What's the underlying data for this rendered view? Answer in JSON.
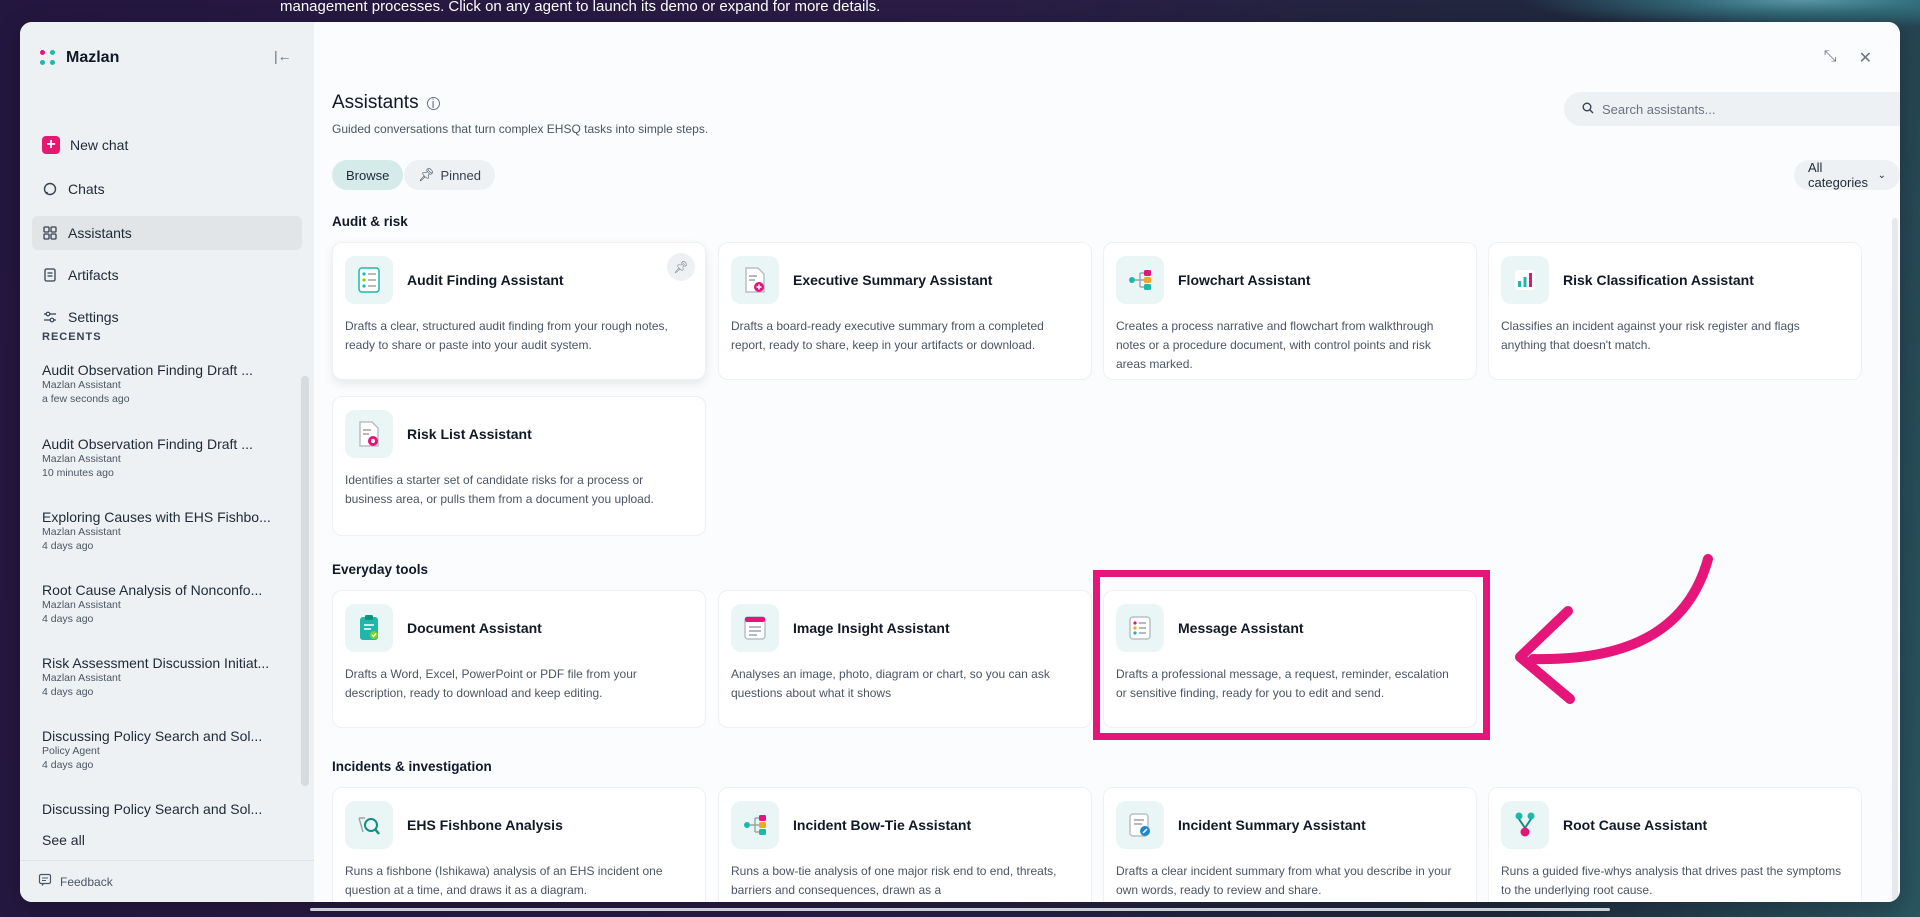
{
  "banner": {
    "text": "management processes. Click on any agent to launch its demo or expand for more details."
  },
  "sidebar": {
    "brand_name": "Mazlan",
    "nav": [
      {
        "label": "New chat",
        "icon": "plus-icon"
      },
      {
        "label": "Chats",
        "icon": "chat-bubble-icon"
      },
      {
        "label": "Assistants",
        "icon": "grid-icon"
      },
      {
        "label": "Artifacts",
        "icon": "document-icon"
      },
      {
        "label": "Settings",
        "icon": "sliders-icon"
      }
    ],
    "recents_label": "RECENTS",
    "recents": [
      {
        "title": "Audit Observation Finding Draft ...",
        "agent": "Mazlan Assistant",
        "time": "a few seconds ago"
      },
      {
        "title": "Audit Observation Finding Draft ...",
        "agent": "Mazlan Assistant",
        "time": "10 minutes ago"
      },
      {
        "title": "Exploring Causes with EHS Fishbo...",
        "agent": "Mazlan Assistant",
        "time": "4 days ago"
      },
      {
        "title": "Root Cause Analysis of Nonconfo...",
        "agent": "Mazlan Assistant",
        "time": "4 days ago"
      },
      {
        "title": "Risk Assessment Discussion Initiat...",
        "agent": "Mazlan Assistant",
        "time": "4 days ago"
      },
      {
        "title": "Discussing Policy Search and Sol...",
        "agent": "Policy Agent",
        "time": "4 days ago"
      },
      {
        "title": "Discussing Policy Search and Sol...",
        "agent": "",
        "time": ""
      }
    ],
    "see_all": "See all",
    "feedback": "Feedback"
  },
  "main": {
    "title": "Assistants",
    "subtitle": "Guided conversations that turn complex EHSQ tasks into simple steps.",
    "search_placeholder": "Search assistants...",
    "filters": {
      "browse": "Browse",
      "pinned": "Pinned"
    },
    "category_select": "All categories",
    "sections": [
      {
        "label": "Audit & risk",
        "cards": [
          {
            "title": "Audit Finding Assistant",
            "desc": "Drafts a clear, structured audit finding from your rough notes, ready to share or paste into your audit system.",
            "icon": "checklist-icon"
          },
          {
            "title": "Executive Summary Assistant",
            "desc": "Drafts a board-ready executive summary from a completed report, ready to share, keep in your artifacts or download.",
            "icon": "document-plus-icon"
          },
          {
            "title": "Flowchart Assistant",
            "desc": "Creates a process narrative and flowchart from walkthrough notes or a procedure document, with control points and risk areas marked.",
            "icon": "flowchart-icon"
          },
          {
            "title": "Risk Classification Assistant",
            "desc": "Classifies an incident against your risk register and flags anything that doesn't match.",
            "icon": "bar-chart-icon"
          },
          {
            "title": "Risk List Assistant",
            "desc": "Identifies a starter set of candidate risks for a process or business area, or pulls them from a document you upload.",
            "icon": "document-badge-icon"
          }
        ]
      },
      {
        "label": "Everyday tools",
        "cards": [
          {
            "title": "Document Assistant",
            "desc": "Drafts a Word, Excel, PowerPoint or PDF file from your description, ready to download and keep editing.",
            "icon": "clipboard-check-icon"
          },
          {
            "title": "Image Insight Assistant",
            "desc": "Analyses an image, photo, diagram or chart, so you can ask questions about what it shows",
            "icon": "image-doc-icon"
          },
          {
            "title": "Message Assistant",
            "desc": "Drafts a professional message, a request, reminder, escalation or sensitive finding, ready for you to edit and send.",
            "icon": "message-list-icon"
          }
        ]
      },
      {
        "label": "Incidents & investigation",
        "cards": [
          {
            "title": "EHS Fishbone Analysis",
            "desc": "Runs a fishbone (Ishikawa) analysis of an EHS incident one question at a time, and draws it as a diagram.",
            "icon": "fishbone-icon"
          },
          {
            "title": "Incident Bow-Tie Assistant",
            "desc": "Runs a bow-tie analysis of one major risk end to end, threats, barriers and consequences, drawn as a",
            "icon": "bowtie-icon"
          },
          {
            "title": "Incident Summary Assistant",
            "desc": "Drafts a clear incident summary from what you describe in your own words, ready to review and share.",
            "icon": "summary-edit-icon"
          },
          {
            "title": "Root Cause Assistant",
            "desc": "Runs a guided five-whys analysis that drives past the symptoms to the underlying root cause.",
            "icon": "root-tree-icon"
          }
        ]
      }
    ]
  },
  "colors": {
    "accent_pink": "#e6157a",
    "teal": "#1fb8a8",
    "sidebar_bg": "#eef1f3"
  }
}
